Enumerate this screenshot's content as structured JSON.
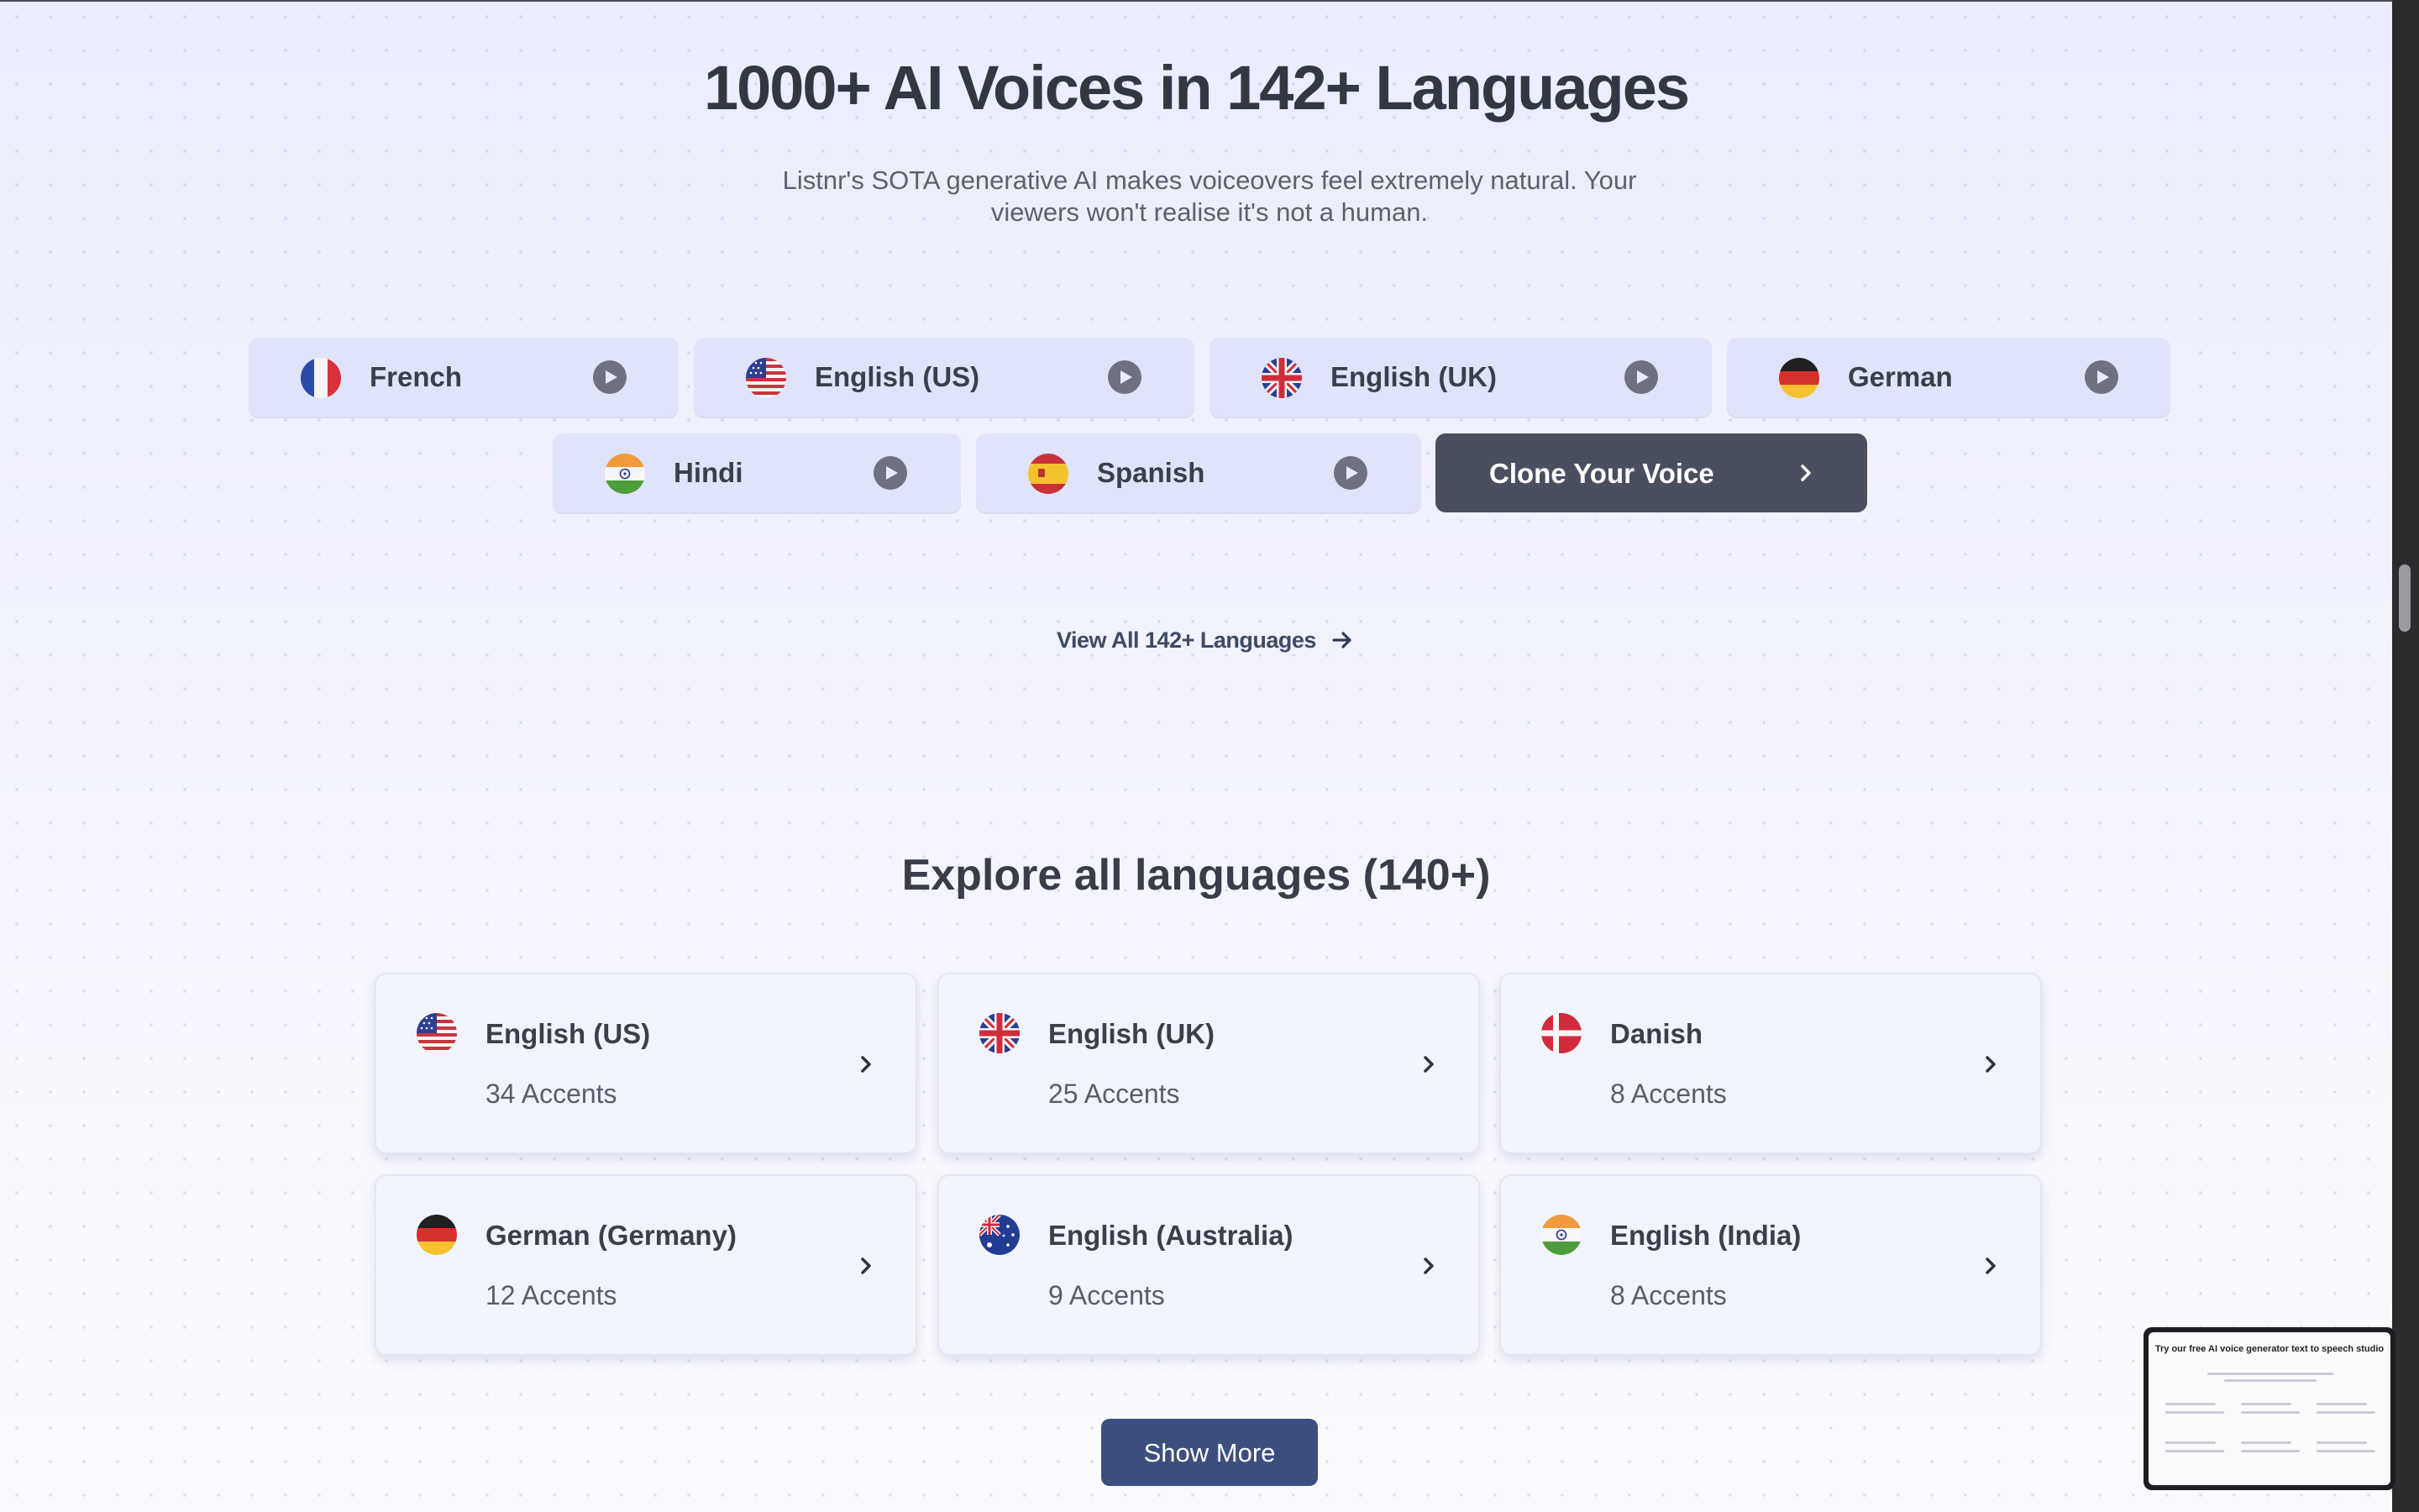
{
  "hero": {
    "title": "1000+ AI Voices in 142+ Languages",
    "subtitle": "Listnr's SOTA generative AI makes voiceovers feel extremely natural. Your viewers won't realise it's not a human."
  },
  "voice_chips": [
    {
      "label": "French",
      "flag": "france-flag-icon"
    },
    {
      "label": "English (US)",
      "flag": "usa-flag-icon"
    },
    {
      "label": "English (UK)",
      "flag": "uk-flag-icon"
    },
    {
      "label": "German",
      "flag": "germany-flag-icon"
    },
    {
      "label": "Hindi",
      "flag": "india-flag-icon"
    },
    {
      "label": "Spanish",
      "flag": "spain-flag-icon"
    }
  ],
  "clone_button": {
    "label": "Clone Your Voice"
  },
  "view_all": {
    "label": "View All 142+ Languages"
  },
  "explore": {
    "title": "Explore all languages (140+)",
    "cards": [
      {
        "name": "English (US)",
        "accents": "34 Accents"
      },
      {
        "name": "English (UK)",
        "accents": "25 Accents"
      },
      {
        "name": "Danish",
        "accents": "8 Accents"
      },
      {
        "name": "German (Germany)",
        "accents": "12 Accents"
      },
      {
        "name": "English (Australia)",
        "accents": "9 Accents"
      },
      {
        "name": "English (India)",
        "accents": "8 Accents"
      }
    ]
  },
  "show_more": {
    "label": "Show More"
  },
  "preview_thumbnail": {
    "title": "Try our free AI voice generator text to speech studio"
  },
  "colors": {
    "accent": "#3d4f7f",
    "clone_bg": "#4a4f60",
    "chip_bg": "#dfe4fb"
  }
}
